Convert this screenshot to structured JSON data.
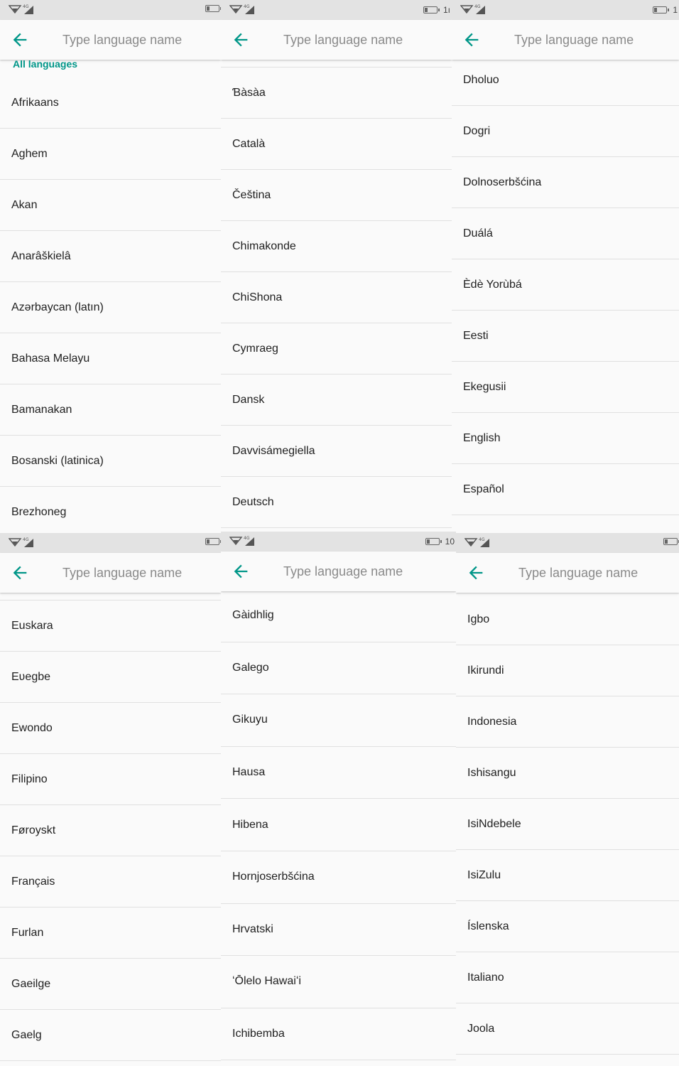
{
  "search": {
    "placeholder": "Type language name"
  },
  "status": {
    "tr1": "1ı",
    "tr2": "1",
    "bm1": "10"
  },
  "colors": {
    "accent": "#009688",
    "statusbar": "#e3e3e3",
    "divider": "#e0e0e0"
  },
  "panels": [
    {
      "section_header": "All languages",
      "items": [
        "Afrikaans",
        "Aghem",
        "Akan",
        "Anarâškielâ",
        "Azərbaycan (latın)",
        "Bahasa Melayu",
        "Bamanakan",
        "Bosanski (latinica)",
        "Brezhoneg"
      ]
    },
    {
      "items": [
        "Ɓàsàa",
        "Català",
        "Čeština",
        "Chimakonde",
        "ChiShona",
        "Cymraeg",
        "Dansk",
        "Davvisámegiella",
        "Deutsch"
      ]
    },
    {
      "items": [
        "Dholuo",
        "Dogri",
        "Dolnoserbšćina",
        "Duálá",
        "Èdè Yorùbá",
        "Eesti",
        "Ekegusii",
        "English",
        "Español"
      ]
    },
    {
      "items": [
        "Euskara",
        "Eʋegbe",
        "Ewondo",
        "Filipino",
        "Føroyskt",
        "Français",
        "Furlan",
        "Gaeilge",
        "Gaelg"
      ]
    },
    {
      "items": [
        "Gàidhlig",
        "Galego",
        "Gikuyu",
        "Hausa",
        "Hibena",
        "Hornjoserbšćina",
        "Hrvatski",
        "ʻŌlelo Hawaiʻi",
        "Ichibemba"
      ]
    },
    {
      "items": [
        "Igbo",
        "Ikirundi",
        "Indonesia",
        "Ishisangu",
        "IsiNdebele",
        "IsiZulu",
        "Íslenska",
        "Italiano",
        "Joola"
      ]
    }
  ]
}
